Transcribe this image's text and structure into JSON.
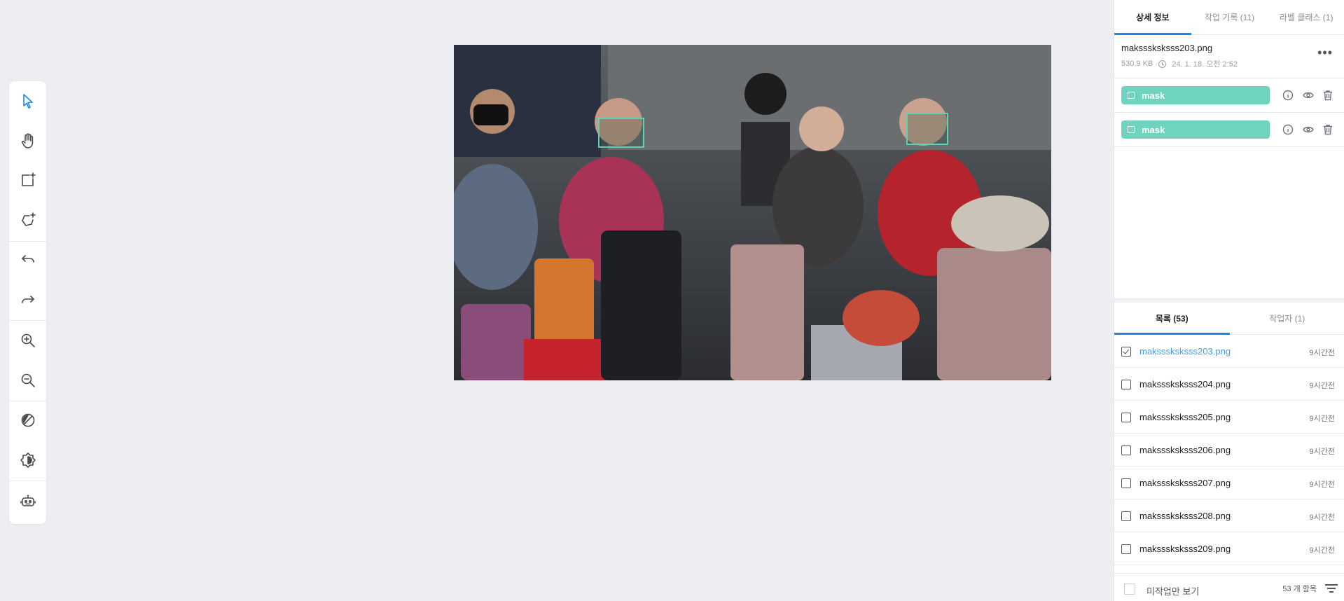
{
  "toolbar": {
    "tools": [
      {
        "name": "select-icon",
        "active": true
      },
      {
        "name": "hand-icon",
        "active": false
      },
      {
        "name": "add-box-icon",
        "active": false
      },
      {
        "name": "add-polygon-icon",
        "active": false
      },
      {
        "name": "undo-icon",
        "active": false
      },
      {
        "name": "redo-icon",
        "active": false
      },
      {
        "name": "zoom-in-icon",
        "active": false
      },
      {
        "name": "zoom-out-icon",
        "active": false
      },
      {
        "name": "contrast-icon",
        "active": false
      },
      {
        "name": "brightness-icon",
        "active": false
      },
      {
        "name": "robot-icon",
        "active": false
      }
    ]
  },
  "canvas": {
    "annotations": [
      {
        "label": "mask"
      },
      {
        "label": "mask"
      }
    ]
  },
  "detail": {
    "tabs": {
      "details": "상세 정보",
      "history": "작업 기록 (11)",
      "classes": "라벨 클래스 (1)"
    },
    "file": {
      "name": "maksssksksss203.png",
      "size": "530.9 KB",
      "date": "24. 1. 18. 오전 2:52"
    },
    "labels": [
      {
        "name": "mask"
      },
      {
        "name": "mask"
      }
    ]
  },
  "list": {
    "tabs": {
      "files": "목록 (53)",
      "workers": "작업자 (1)"
    },
    "items": [
      {
        "name": "maksssksksss203.png",
        "time": "9시간전",
        "selected": true
      },
      {
        "name": "maksssksksss204.png",
        "time": "9시간전",
        "selected": false
      },
      {
        "name": "maksssksksss205.png",
        "time": "9시간전",
        "selected": false
      },
      {
        "name": "maksssksksss206.png",
        "time": "9시간전",
        "selected": false
      },
      {
        "name": "maksssksksss207.png",
        "time": "9시간전",
        "selected": false
      },
      {
        "name": "maksssksksss208.png",
        "time": "9시간전",
        "selected": false
      },
      {
        "name": "maksssksksss209.png",
        "time": "9시간전",
        "selected": false
      }
    ]
  },
  "footer": {
    "unworked_only": "미작업만 보기",
    "count": "53 개 항목"
  },
  "colors": {
    "accent": "#1e88e5",
    "label": "#6fd3bd",
    "selected_item": "#4a9ee8",
    "background": "#edeef2"
  }
}
